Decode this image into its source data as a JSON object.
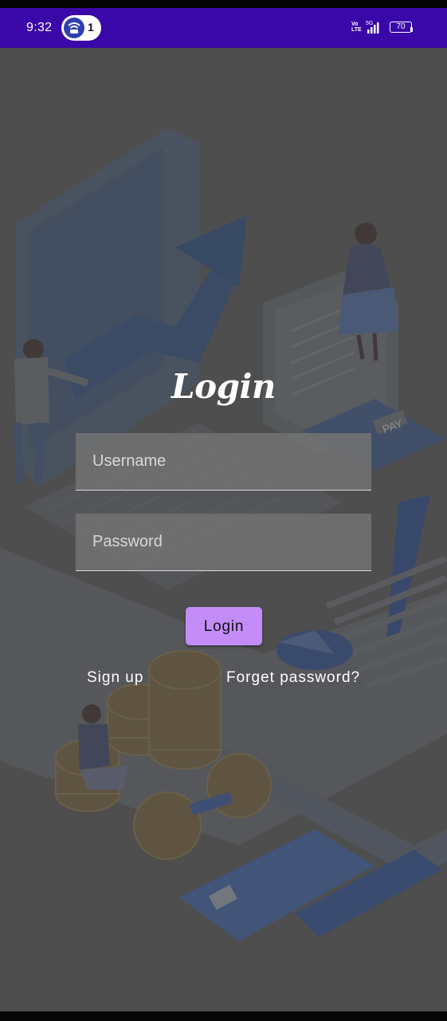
{
  "status_bar": {
    "time": "9:32",
    "hotspot_count": "1",
    "volte_label": "Vo\nLTE",
    "network_label": "5G",
    "battery_level": "70",
    "background_color": "#3a07a8"
  },
  "login": {
    "title": "Login",
    "username_placeholder": "Username",
    "password_placeholder": "Password",
    "login_button_label": "Login",
    "signup_label": "Sign up",
    "forget_password_label": "Forget password?",
    "button_color": "#c38cf6"
  },
  "background_text": {
    "pay_label": "PAY"
  }
}
